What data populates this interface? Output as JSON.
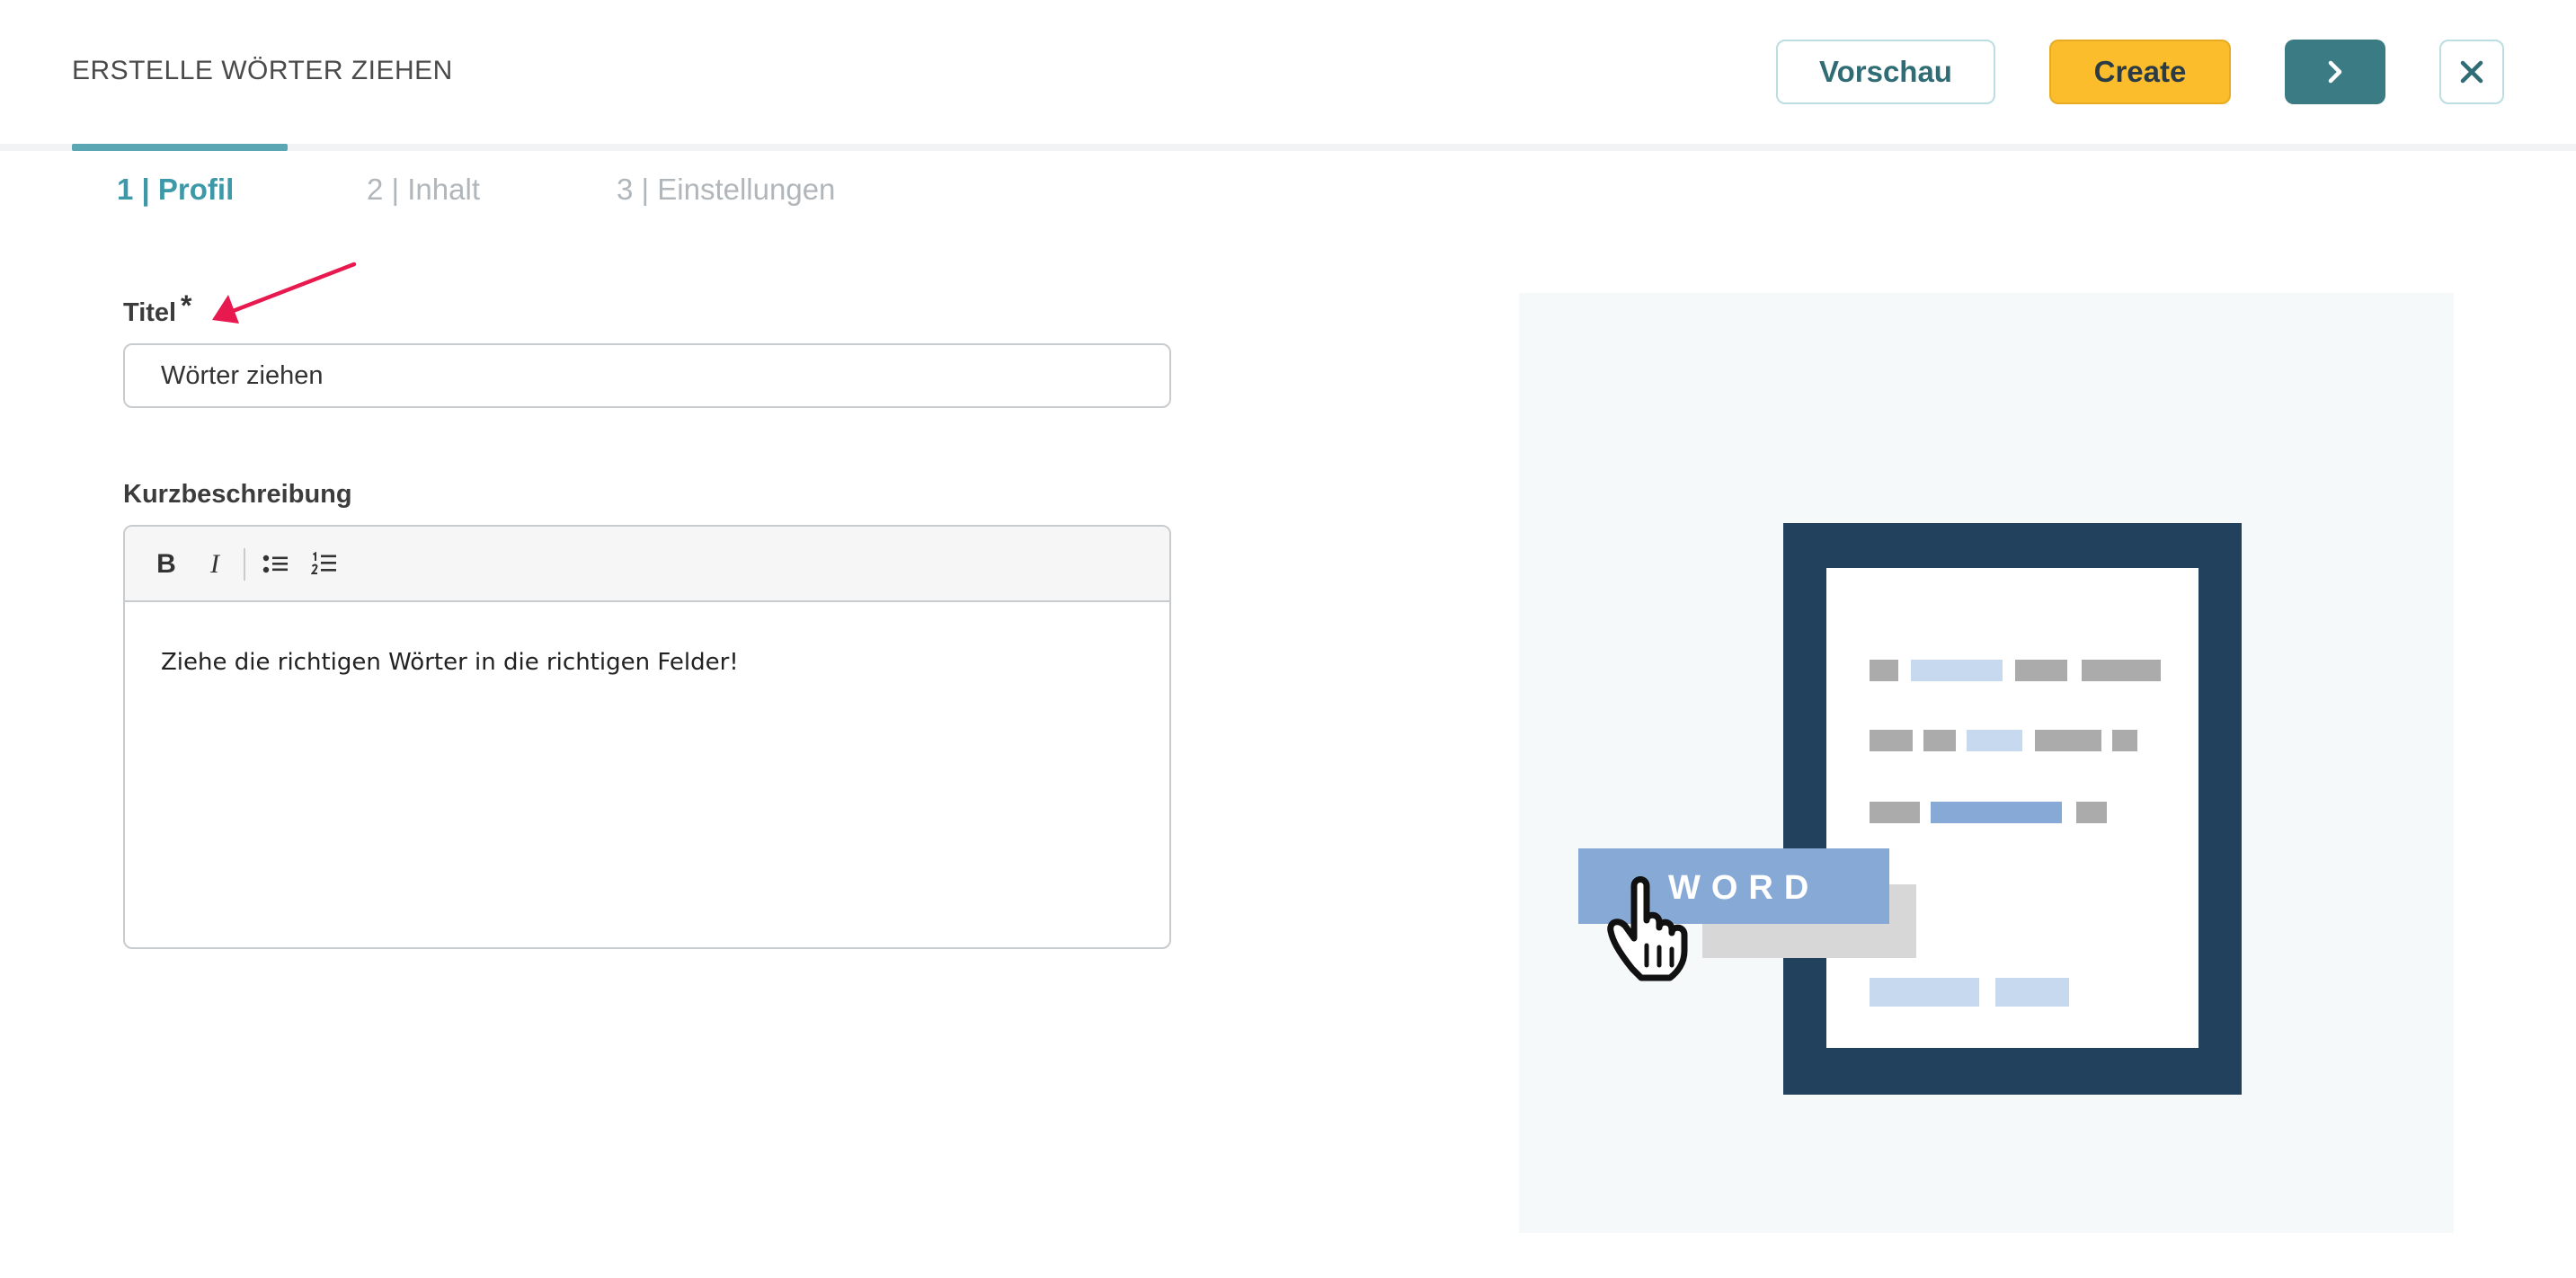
{
  "header": {
    "title": "ERSTELLE WÖRTER ZIEHEN",
    "preview_label": "Vorschau",
    "create_label": "Create",
    "next_icon": "chevron-right-icon",
    "close_icon": "close-icon"
  },
  "tabs": [
    {
      "label": "1 | Profil",
      "active": true
    },
    {
      "label": "2 | Inhalt",
      "active": false
    },
    {
      "label": "3 | Einstellungen",
      "active": false
    }
  ],
  "form": {
    "title_label": "Titel",
    "required_marker": "*",
    "title_value": "Wörter ziehen",
    "description_label": "Kurzbeschreibung",
    "description_value": "Ziehe die richtigen Wörter in die richtigen Felder!",
    "toolbar": {
      "bold_label": "B",
      "italic_label": "I",
      "bullet_list_icon": "bullet-list-icon",
      "numbered_list_icon": "numbered-list-icon"
    }
  },
  "illustration": {
    "word_label": "WORD",
    "hand_icon": "hand-pointer-icon"
  },
  "colors": {
    "accent_teal": "#3d98a8",
    "create_yellow": "#fbbd2b",
    "next_teal": "#3b7b83",
    "annotation_arrow": "#e8194f",
    "illustration_navy": "#22415c"
  }
}
